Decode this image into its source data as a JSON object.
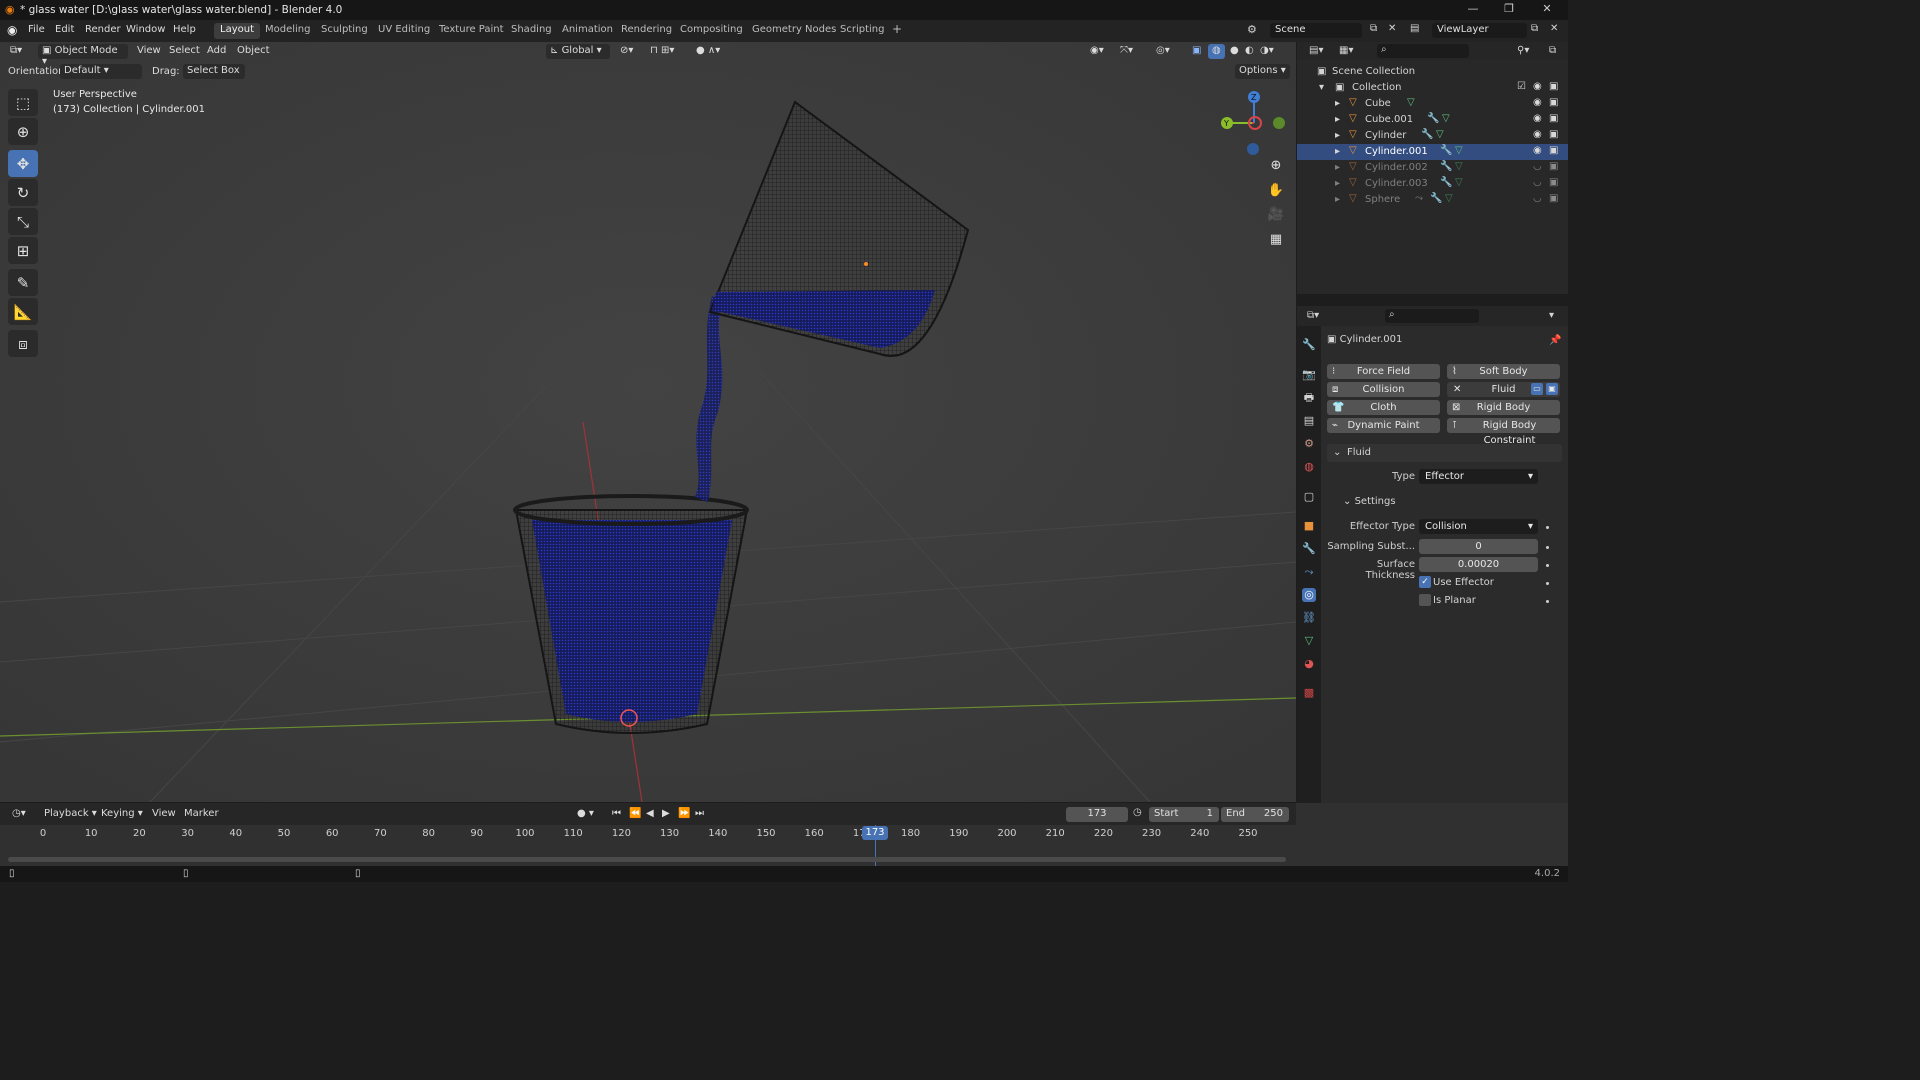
{
  "window": {
    "title": "* glass water [D:\\glass water\\glass water.blend] - Blender 4.0"
  },
  "menu": [
    "File",
    "Edit",
    "Render",
    "Window",
    "Help"
  ],
  "workspaces": [
    "Layout",
    "Modeling",
    "Sculpting",
    "UV Editing",
    "Texture Paint",
    "Shading",
    "Animation",
    "Rendering",
    "Compositing",
    "Geometry Nodes",
    "Scripting"
  ],
  "active_workspace": "Layout",
  "scene": {
    "name": "Scene",
    "view_layer": "ViewLayer"
  },
  "viewport_header": {
    "mode": "Object Mode",
    "menus": [
      "View",
      "Select",
      "Add",
      "Object"
    ],
    "transform_orientation": "Global",
    "orientation_label": "Orientation:",
    "orientation_value": "Default",
    "drag_label": "Drag:",
    "drag_value": "Select Box",
    "options": "Options"
  },
  "viewport": {
    "perspective": "User Perspective",
    "context": "(173) Collection | Cylinder.001"
  },
  "outliner": {
    "root": "Scene Collection",
    "collection": "Collection",
    "objects": [
      {
        "name": "Cube",
        "dim": false
      },
      {
        "name": "Cube.001",
        "dim": false
      },
      {
        "name": "Cylinder",
        "dim": false
      },
      {
        "name": "Cylinder.001",
        "dim": false,
        "selected": true
      },
      {
        "name": "Cylinder.002",
        "dim": true
      },
      {
        "name": "Cylinder.003",
        "dim": true
      },
      {
        "name": "Sphere",
        "dim": true
      }
    ]
  },
  "properties": {
    "object_name": "Cylinder.001",
    "physics_buttons": [
      {
        "label": "Force Field"
      },
      {
        "label": "Soft Body"
      },
      {
        "label": "Collision"
      },
      {
        "label": "Fluid"
      },
      {
        "label": "Cloth"
      },
      {
        "label": "Rigid Body"
      },
      {
        "label": "Dynamic Paint"
      },
      {
        "label": "Rigid Body Constraint"
      }
    ],
    "fluid_panel": "Fluid",
    "type_label": "Type",
    "type_value": "Effector",
    "settings_panel": "Settings",
    "effector_type_label": "Effector Type",
    "effector_type_value": "Collision",
    "sampling_label": "Sampling Subst...",
    "sampling_value": "0",
    "thickness_label": "Surface Thickness",
    "thickness_value": "0.00020",
    "use_effector_label": "Use Effector",
    "use_effector": true,
    "is_planar_label": "Is Planar",
    "is_planar": false
  },
  "timeline": {
    "menus": [
      "Playback",
      "Keying",
      "View",
      "Marker"
    ],
    "current_frame": "173",
    "start_label": "Start",
    "start": "1",
    "end_label": "End",
    "end": "250",
    "ticks": [
      "0",
      "10",
      "20",
      "30",
      "40",
      "50",
      "60",
      "70",
      "80",
      "90",
      "100",
      "110",
      "120",
      "130",
      "140",
      "150",
      "160",
      "170",
      "180",
      "190",
      "200",
      "210",
      "220",
      "230",
      "240",
      "250"
    ]
  },
  "status": {
    "version": "4.0.2"
  },
  "colors": {
    "accent": "#4772b3",
    "viewport_bg": "#3b3b3b",
    "panel_bg": "#2b2b2b",
    "water": "#1f2a9c"
  },
  "icons": [
    "blender-logo-icon",
    "select-box-icon",
    "cursor-icon",
    "move-icon",
    "rotate-icon",
    "scale-icon",
    "transform-icon",
    "annotate-icon",
    "measure-icon",
    "add-cube-icon",
    "zoom-icon",
    "pan-hand-icon",
    "camera-icon",
    "grid-icon",
    "eye-icon",
    "camera-render-icon",
    "filter-icon",
    "search-icon",
    "pin-icon"
  ]
}
